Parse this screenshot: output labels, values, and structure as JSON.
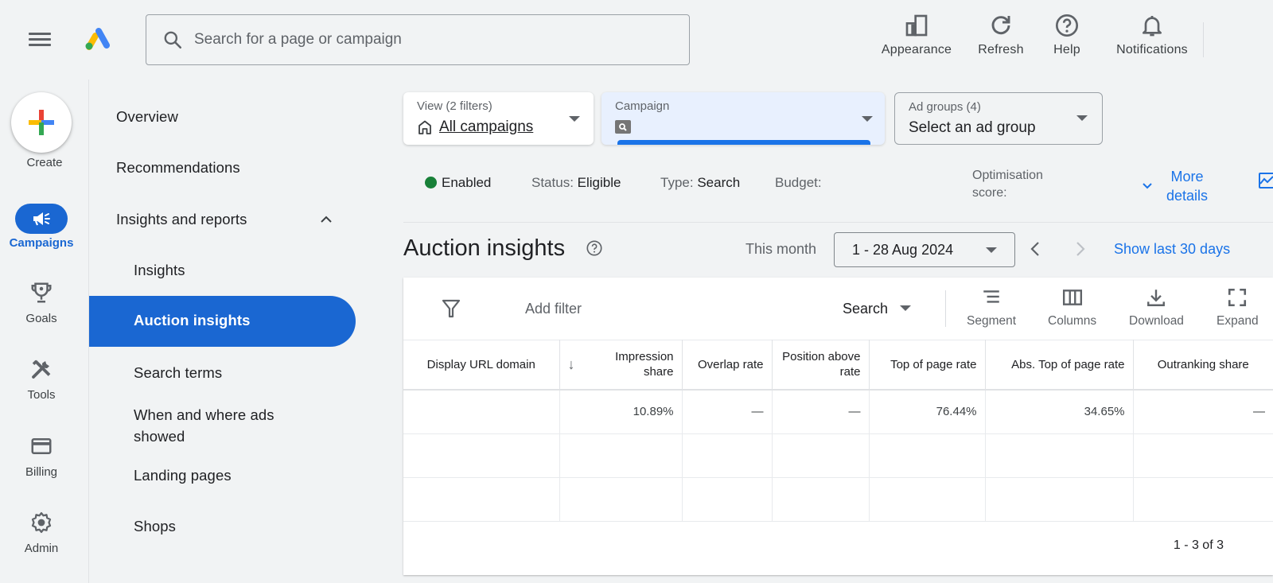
{
  "header": {
    "search_placeholder": "Search for a page or campaign",
    "actions": [
      {
        "label": "Appearance",
        "icon": "appearance-icon"
      },
      {
        "label": "Refresh",
        "icon": "refresh-icon"
      },
      {
        "label": "Help",
        "icon": "help-icon"
      },
      {
        "label": "Notifications",
        "icon": "bell-icon"
      }
    ]
  },
  "rail": {
    "create_label": "Create",
    "items": [
      {
        "label": "Campaigns",
        "icon": "megaphone-icon",
        "active": true
      },
      {
        "label": "Goals",
        "icon": "trophy-icon"
      },
      {
        "label": "Tools",
        "icon": "tools-icon"
      },
      {
        "label": "Billing",
        "icon": "credit-card-icon"
      },
      {
        "label": "Admin",
        "icon": "gear-icon"
      }
    ]
  },
  "subnav": {
    "items": [
      {
        "label": "Overview"
      },
      {
        "label": "Recommendations"
      },
      {
        "label": "Insights and reports",
        "expanded": true
      },
      {
        "label": "Insights"
      },
      {
        "label": "Auction insights",
        "active": true
      },
      {
        "label": "Search terms"
      },
      {
        "label": "When and where ads showed"
      },
      {
        "label": "Landing pages"
      },
      {
        "label": "Shops"
      }
    ]
  },
  "filters": {
    "view": {
      "label": "View (2 filters)",
      "value": "All campaigns"
    },
    "campaign": {
      "label": "Campaign",
      "value": ""
    },
    "ad_groups": {
      "label": "Ad groups (4)",
      "value": "Select an ad group"
    }
  },
  "status": {
    "enabled": "Enabled",
    "status_label": "Status:",
    "status_value": "Eligible",
    "type_label": "Type:",
    "type_value": "Search",
    "budget_label": "Budget:",
    "opt_score_line1": "Optimisation",
    "opt_score_line2": "score:",
    "more_details_line1": "More",
    "more_details_line2": "details",
    "enabled_color": "#188038"
  },
  "page": {
    "title": "Auction insights",
    "date_preset": "This month",
    "date_range": "1 - 28 Aug 2024",
    "show_last": "Show last 30 days"
  },
  "toolbar": {
    "add_filter": "Add filter",
    "search_dropdown": "Search",
    "buttons": [
      {
        "label": "Segment",
        "icon": "segment-icon"
      },
      {
        "label": "Columns",
        "icon": "columns-icon"
      },
      {
        "label": "Download",
        "icon": "download-icon"
      },
      {
        "label": "Expand",
        "icon": "expand-icon"
      }
    ]
  },
  "table": {
    "columns": [
      "Display URL domain",
      "Impression share",
      "Overlap rate",
      "Position above rate",
      "Top of page rate",
      "Abs. Top of page rate",
      "Outranking share"
    ],
    "rows": [
      [
        "",
        "10.89%",
        "—",
        "—",
        "76.44%",
        "34.65%",
        "—"
      ],
      [
        "",
        "",
        "",
        "",
        "",
        "",
        ""
      ],
      [
        "",
        "",
        "",
        "",
        "",
        "",
        ""
      ]
    ],
    "pagination": "1 - 3 of 3"
  },
  "colors": {
    "accent": "#1a67d2",
    "link": "#1a73e8",
    "background": "#f1f3f4"
  }
}
